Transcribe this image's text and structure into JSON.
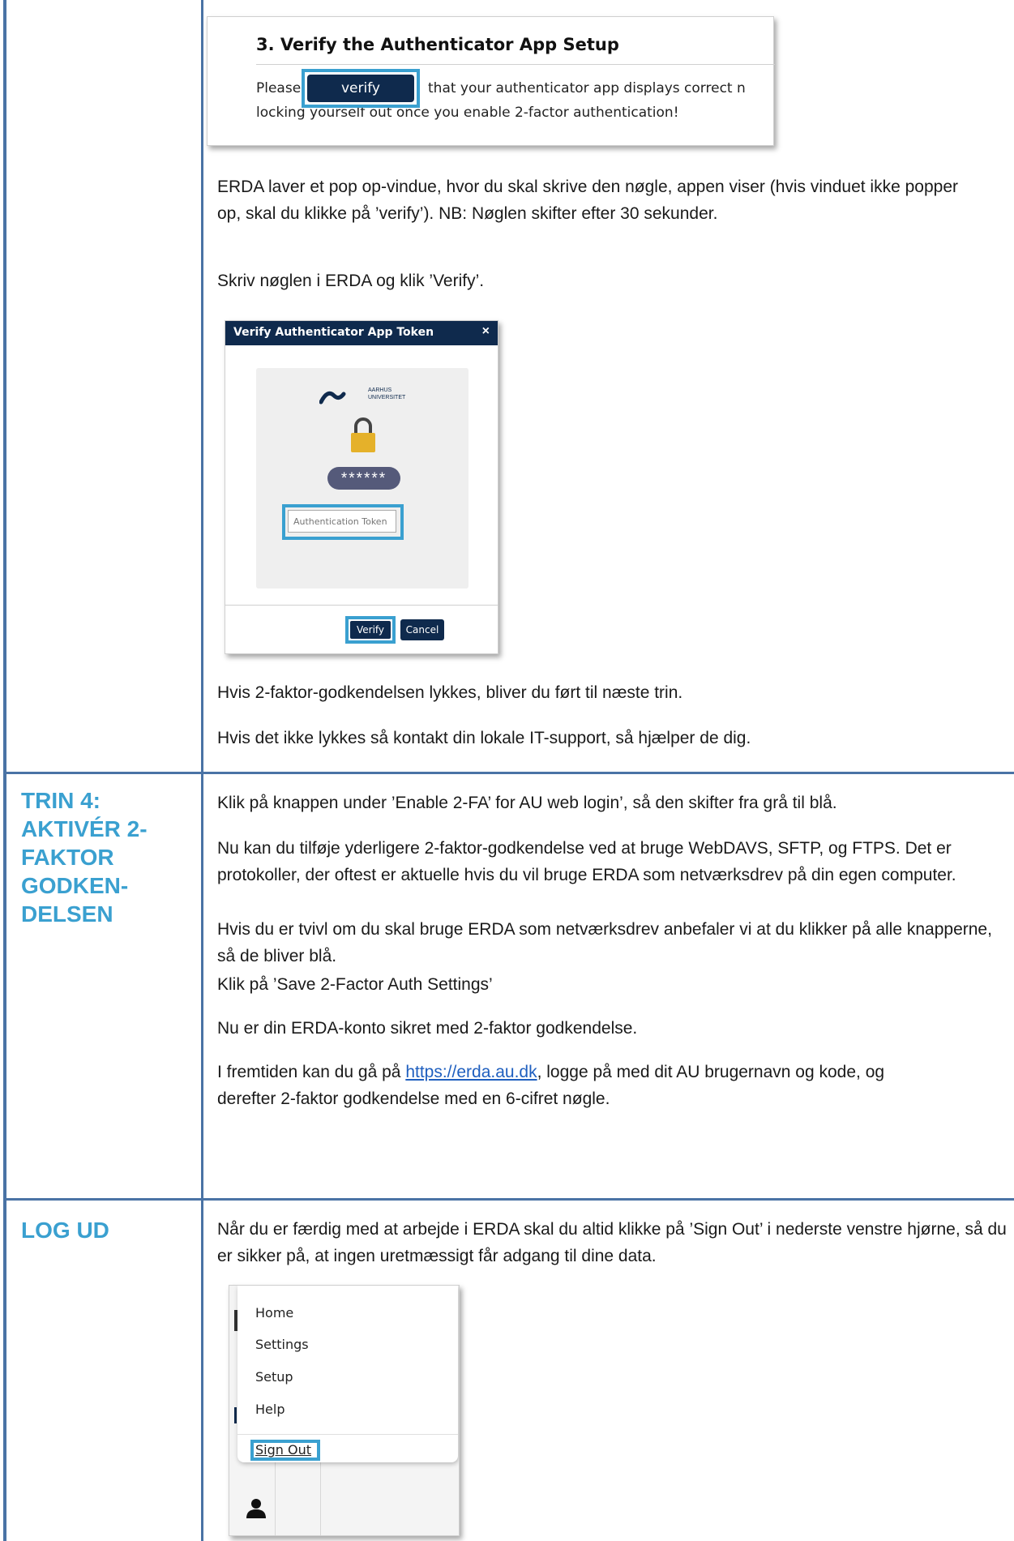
{
  "step3_shot": {
    "title": "3. Verify the Authenticator App Setup",
    "verify_button": "verify",
    "line1_pre": "Please",
    "line1_post": "that your authenticator app displays correct n",
    "line2": "locking yourself out once you enable 2-factor authentication!"
  },
  "step3_text": {
    "p1": "ERDA laver et pop op-vindue, hvor du skal skrive den nøgle, appen viser (hvis vinduet ikke popper op, skal du klikke på ’verify’). NB: Nøglen skifter efter 30 sekunder.",
    "p2": "Skriv nøglen i ERDA og klik ’Verify’.",
    "p3": "Hvis 2-faktor-godkendelsen lykkes, bliver du ført til næste trin.",
    "p4": "Hvis det ikke lykkes så kontakt din lokale IT-support, så hjælper de dig."
  },
  "modal": {
    "title": "Verify Authenticator App Token",
    "close": "×",
    "logo_line1": "AARHUS",
    "logo_line2": "UNIVERSITET",
    "stars": "******",
    "token_placeholder": "Authentication Token",
    "verify_button": "Verify",
    "cancel_button": "Cancel"
  },
  "step4": {
    "heading": [
      "TRIN 4:",
      "AKTIVÉR 2-",
      "FAKTOR",
      "GODKEN-",
      "DELSEN"
    ],
    "p1": "Klik på knappen under ’Enable 2-FA’ for AU web login’, så den skifter fra grå til blå.",
    "p2": "Nu kan du tilføje yderligere 2-faktor-godkendelse ved at bruge WebDAVS, SFTP, og FTPS. Det er protokoller, der oftest er aktuelle hvis du vil bruge ERDA som netværksdrev på din egen computer.",
    "p3": "Hvis du er tvivl om du skal bruge ERDA som netværksdrev anbefaler vi at du klikker på alle knapperne, så de bliver blå.",
    "p4": "Klik på ’Save 2-Factor Auth Settings’",
    "p5": "Nu er din ERDA-konto sikret med 2-faktor godkendelse.",
    "p6_pre": "I fremtiden kan du gå på ",
    "p6_link": "https://erda.au.dk",
    "p6_post": ", logge på med dit AU brugernavn og kode, og derefter 2-faktor godkendelse med en 6-cifret nøgle."
  },
  "logout": {
    "heading": "LOG UD",
    "p1": "Når du er færdig med at arbejde i ERDA skal du altid klikke på ’Sign Out’ i nederste venstre hjørne, så du er sikker på, at ingen uretmæssigt får adgang til dine data.",
    "menu": [
      "Home",
      "Settings",
      "Setup",
      "Help"
    ],
    "sign_out": "Sign Out"
  },
  "colors": {
    "accent": "#3aa0d0",
    "border": "#4a73a5",
    "navy": "#0f2a4d",
    "link": "#1f5fbf"
  },
  "icons": [
    "au-logo-icon",
    "padlock-icon",
    "user-icon"
  ]
}
